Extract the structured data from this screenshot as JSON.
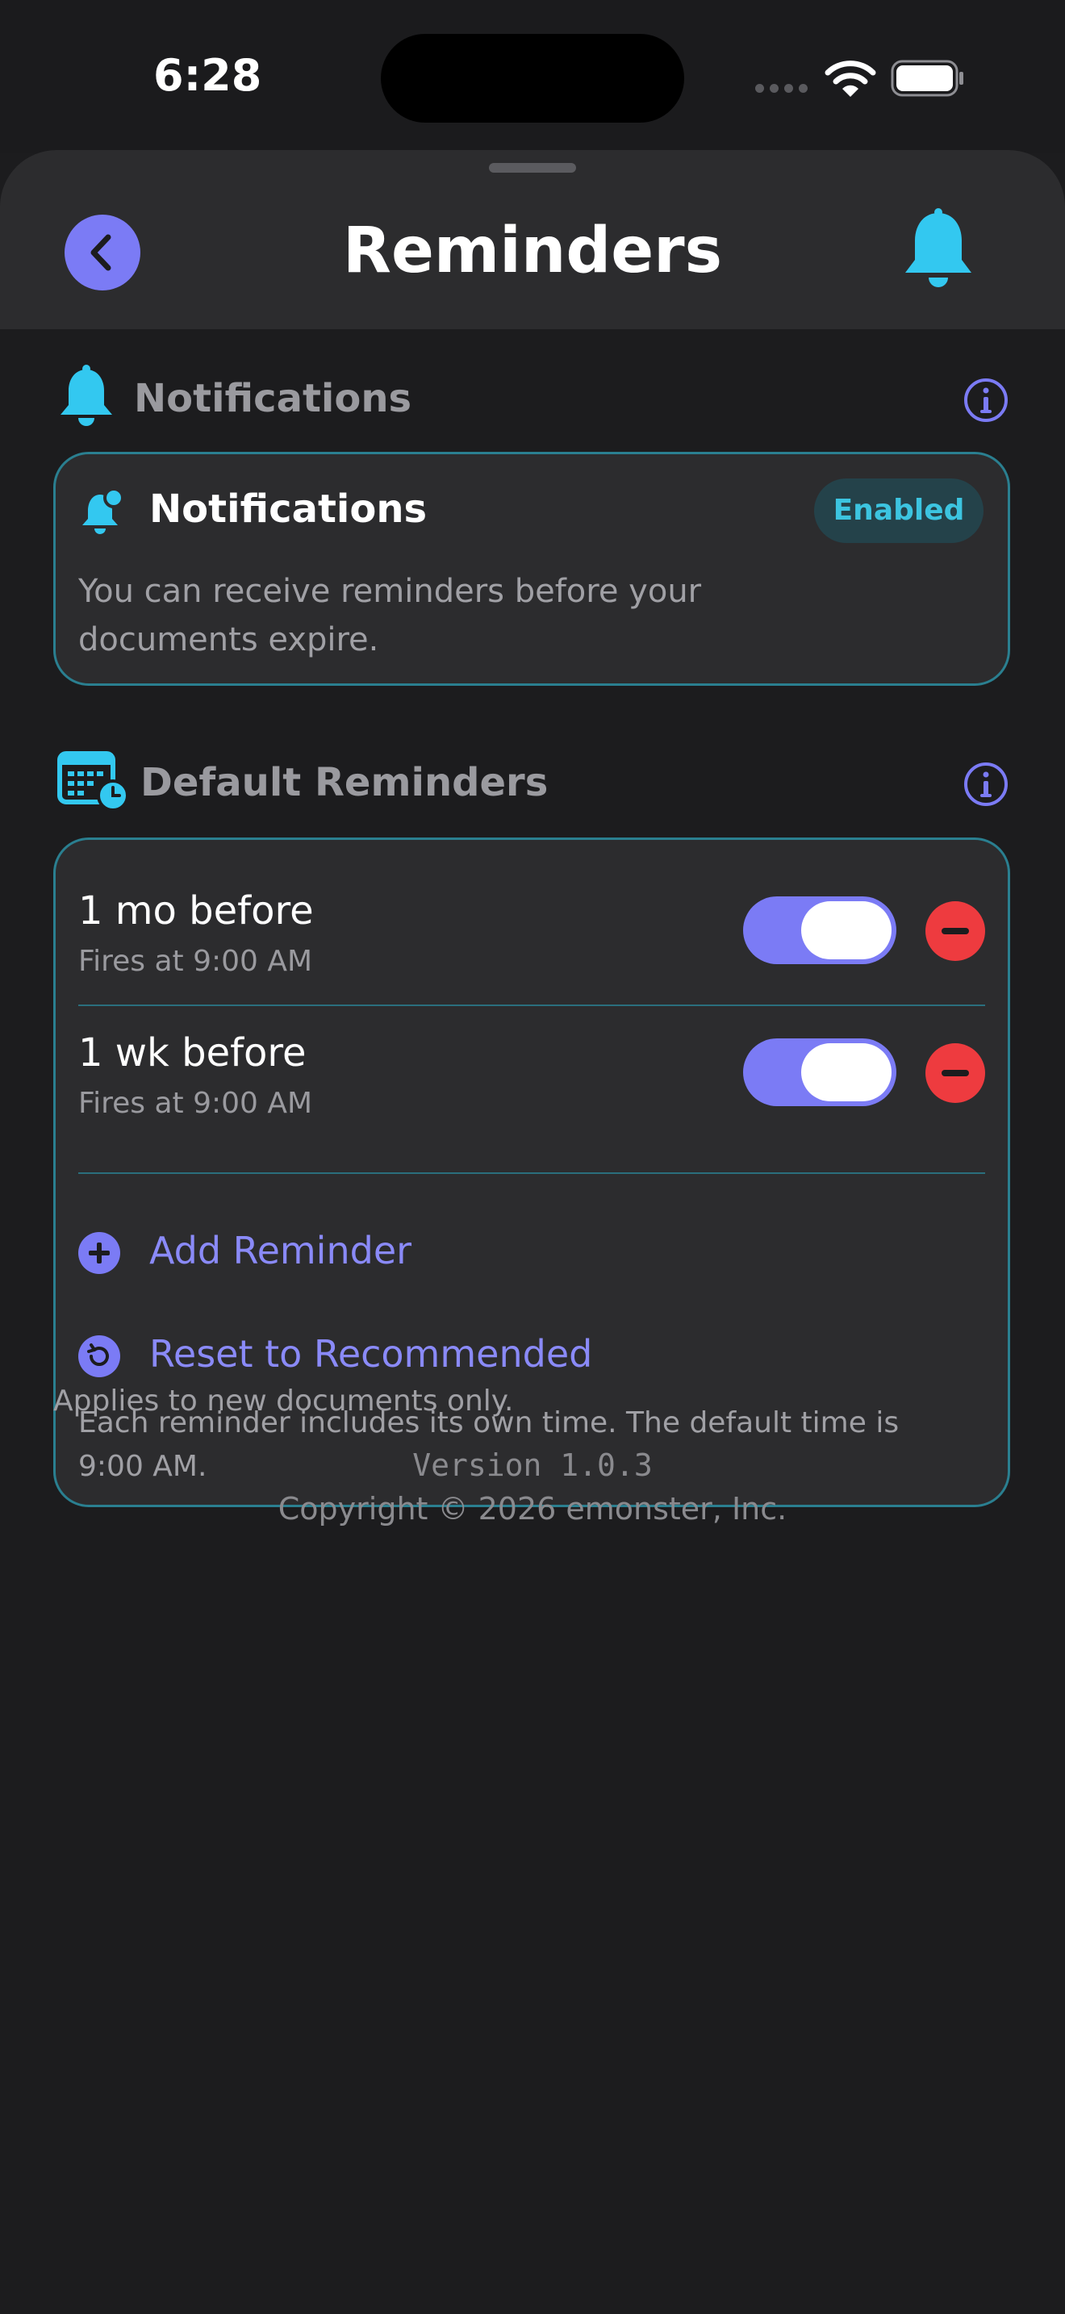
{
  "status_bar": {
    "time": "6:28"
  },
  "header": {
    "title": "Reminders",
    "back_icon": "chevron-left-icon",
    "bell_icon": "bell-icon"
  },
  "notifications_section": {
    "title": "Notifications",
    "card": {
      "title": "Notifications",
      "badge": "Enabled",
      "description": "You can receive reminders before your documents expire."
    }
  },
  "default_reminders_section": {
    "title": "Default Reminders",
    "reminders": [
      {
        "label": "1 mo before",
        "subtitle": "Fires at 9:00 AM",
        "enabled": true
      },
      {
        "label": "1 wk before",
        "subtitle": "Fires at 9:00 AM",
        "enabled": true
      }
    ],
    "add_label": "Add Reminder",
    "reset_label": "Reset to Recommended",
    "note": "Each reminder includes its own time. The default time is 9:00 AM."
  },
  "footer": {
    "applies_note": "Applies to new documents only.",
    "version": "Version 1.0.3",
    "copyright": "Copyright © 2026 emonster, Inc."
  },
  "colors": {
    "accent": "#7b7bf5",
    "cyan": "#33c8f0",
    "card_border": "#2a7f90",
    "danger": "#ee3b3f",
    "background": "#1c1c1e",
    "card": "#2c2c2e"
  }
}
